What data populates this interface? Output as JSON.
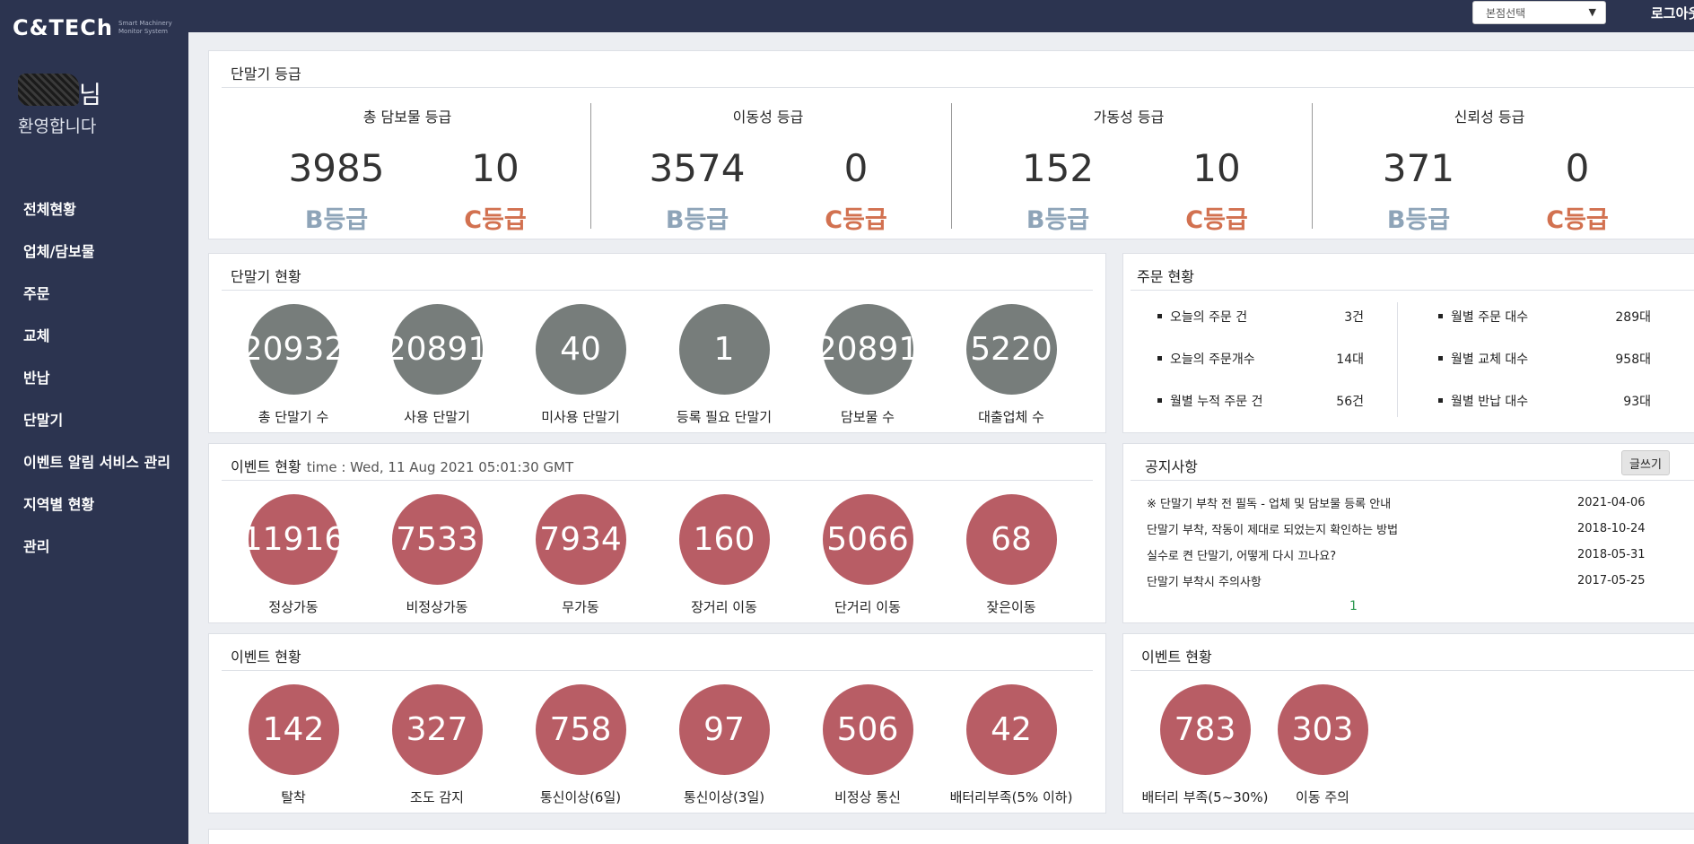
{
  "app": {
    "logo_text": "C&TECh",
    "logo_subtitle": "Smart Machinery Monitor System",
    "user_suffix": "님",
    "welcome": "환영합니다"
  },
  "sidebar": {
    "items": [
      {
        "label": "전체현황"
      },
      {
        "label": "업체/담보물"
      },
      {
        "label": "주문"
      },
      {
        "label": "교체"
      },
      {
        "label": "반납"
      },
      {
        "label": "단말기"
      },
      {
        "label": "이벤트 알림 서비스 관리"
      },
      {
        "label": "지역별 현황"
      },
      {
        "label": "관리"
      }
    ]
  },
  "header": {
    "branch_select": "본점선택",
    "logout": "로그아웃"
  },
  "grades": {
    "title": "단말기 등급",
    "columns": [
      {
        "name": "총 담보물 등급",
        "b_value": "3985",
        "c_value": "10"
      },
      {
        "name": "이동성 등급",
        "b_value": "3574",
        "c_value": "0"
      },
      {
        "name": "가동성 등급",
        "b_value": "152",
        "c_value": "10"
      },
      {
        "name": "신뢰성 등급",
        "b_value": "371",
        "c_value": "0"
      }
    ],
    "b_label": "B등급",
    "c_label": "C등급"
  },
  "terminal_status": {
    "title": "단말기 현황",
    "items": [
      {
        "value": "20932",
        "label": "총 단말기 수"
      },
      {
        "value": "20891",
        "label": "사용 단말기"
      },
      {
        "value": "40",
        "label": "미사용 단말기"
      },
      {
        "value": "1",
        "label": "등록 필요 단말기"
      },
      {
        "value": "20891",
        "label": "담보물 수"
      },
      {
        "value": "5220",
        "label": "대출업체 수"
      }
    ]
  },
  "order_status": {
    "title": "주문 현황",
    "left": [
      {
        "label": "오늘의 주문 건",
        "value": "3건"
      },
      {
        "label": "오늘의 주문개수",
        "value": "14대"
      },
      {
        "label": "월별 누적 주문 건",
        "value": "56건"
      }
    ],
    "right": [
      {
        "label": "월별 주문 대수",
        "value": "289대"
      },
      {
        "label": "월별 교체 대수",
        "value": "958대"
      },
      {
        "label": "월별 반납 대수",
        "value": "93대"
      }
    ]
  },
  "event_status_1": {
    "title": "이벤트 현황",
    "time": "time : Wed, 11 Aug 2021 05:01:30 GMT",
    "items": [
      {
        "value": "11916",
        "label": "정상가동"
      },
      {
        "value": "7533",
        "label": "비정상가동"
      },
      {
        "value": "7934",
        "label": "무가동"
      },
      {
        "value": "160",
        "label": "장거리 이동"
      },
      {
        "value": "5066",
        "label": "단거리 이동"
      },
      {
        "value": "68",
        "label": "잦은이동"
      }
    ]
  },
  "notices": {
    "title": "공지사항",
    "write_button": "글쓰기",
    "items": [
      {
        "title": "※ 단말기 부착 전 필독 - 업체 및 담보물 등록 안내",
        "date": "2021-04-06"
      },
      {
        "title": "단말기 부착, 작동이 제대로 되었는지 확인하는 방법",
        "date": "2018-10-24"
      },
      {
        "title": "실수로 켠 단말기, 어떻게 다시 끄나요?",
        "date": "2018-05-31"
      },
      {
        "title": "단말기 부착시 주의사항",
        "date": "2017-05-25"
      }
    ],
    "page": "1"
  },
  "event_status_2": {
    "title": "이벤트 현황",
    "items": [
      {
        "value": "142",
        "label": "탈착"
      },
      {
        "value": "327",
        "label": "조도 감지"
      },
      {
        "value": "758",
        "label": "통신이상(6일)"
      },
      {
        "value": "97",
        "label": "통신이상(3일)"
      },
      {
        "value": "506",
        "label": "비정상 통신"
      },
      {
        "value": "42",
        "label": "배터리부족(5% 이하)"
      }
    ]
  },
  "event_status_3": {
    "title": "이벤트 현황",
    "items": [
      {
        "value": "783",
        "label": "배터리 부족(5~30%)"
      },
      {
        "value": "303",
        "label": "이동 주의"
      }
    ]
  },
  "colors": {
    "sidebar_bg": "#2c3450",
    "circle_gray": "#777d7b",
    "circle_red": "#b85d65",
    "grade_b": "#8ea4b8",
    "grade_c": "#d27150"
  }
}
